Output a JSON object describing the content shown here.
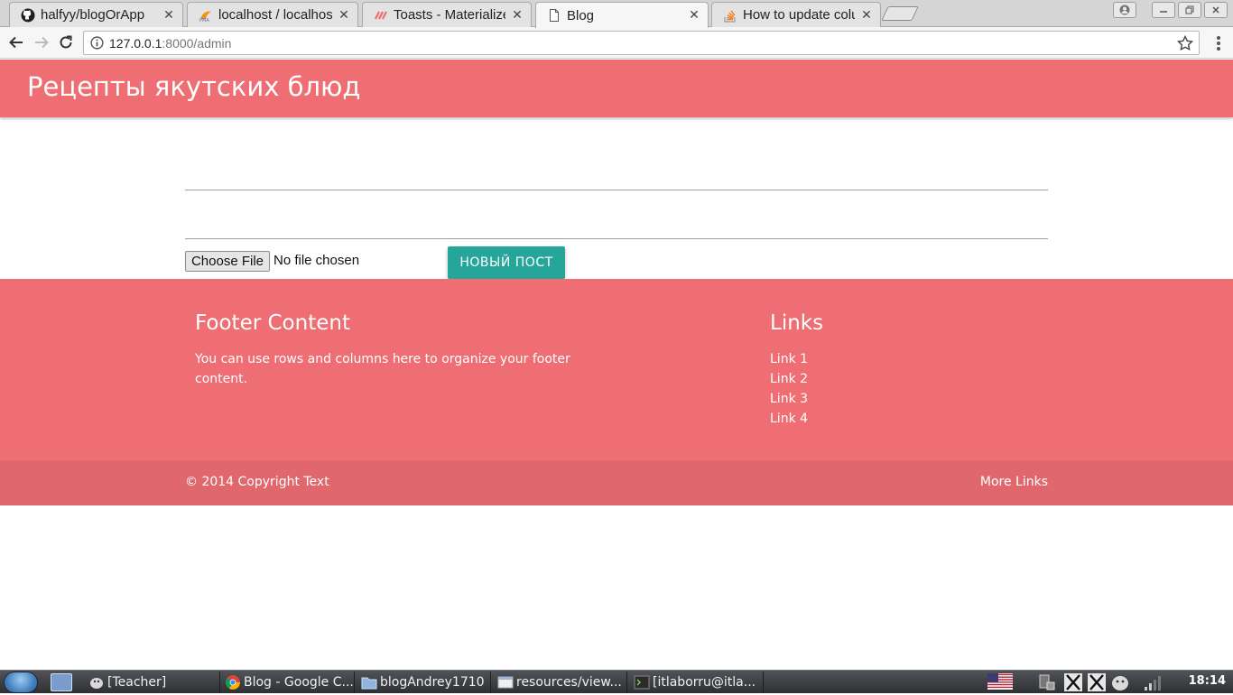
{
  "browser": {
    "tabs": [
      {
        "title": "halfyy/blogOrApp",
        "icon": "github-icon",
        "active": false
      },
      {
        "title": "localhost / localhos",
        "icon": "phpmyadmin-icon",
        "active": false
      },
      {
        "title": "Toasts - Materialize",
        "icon": "materialize-icon",
        "active": false
      },
      {
        "title": "Blog",
        "icon": "document-icon",
        "active": true
      },
      {
        "title": "How to update colu",
        "icon": "stackoverflow-icon",
        "active": false
      }
    ],
    "close_glyph": "✕",
    "url_host": "127.0.0.1",
    "url_rest": ":8000/admin"
  },
  "page": {
    "header_title": "Рецепты якутских блюд",
    "file_button": "Choose File",
    "file_status": "No file chosen",
    "submit_label": "НОВЫЙ ПОСТ",
    "accent_color": "#ef6e73",
    "button_color": "#26a69a"
  },
  "footer": {
    "heading": "Footer Content",
    "text": "You can use rows and columns here to organize your footer content.",
    "links_heading": "Links",
    "links": [
      "Link 1",
      "Link 2",
      "Link 3",
      "Link 4"
    ],
    "copyright": "© 2014 Copyright Text",
    "more_links": "More Links"
  },
  "taskbar": {
    "tasks": [
      {
        "label": "[Teacher]",
        "icon": "pidgin-icon"
      },
      {
        "label": "Blog - Google C...",
        "icon": "chrome-icon"
      },
      {
        "label": "blogAndrey1710",
        "icon": "folder-icon"
      },
      {
        "label": "resources/view...",
        "icon": "editor-icon"
      },
      {
        "label": "[itlaborru@itla...",
        "icon": "terminal-icon"
      }
    ],
    "clock": "18:14"
  }
}
